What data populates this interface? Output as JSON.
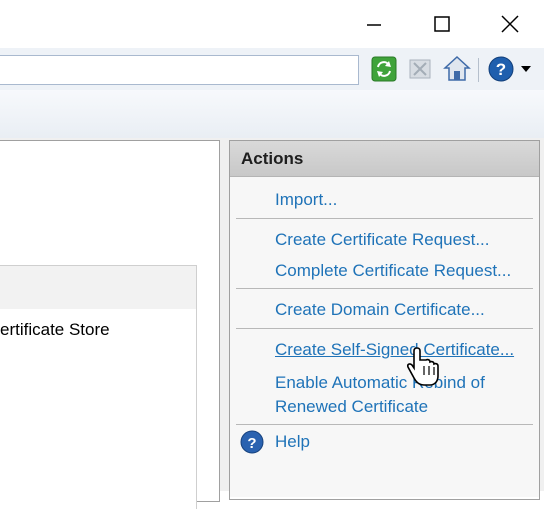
{
  "window": {
    "controls": {
      "minimize": "minimize-icon",
      "maximize": "maximize-icon",
      "close": "close-icon"
    }
  },
  "toolbar": {
    "address_value": "",
    "buttons": [
      "refresh-icon",
      "stop-icon",
      "home-icon",
      "help-icon",
      "dropdown-arrow-icon"
    ]
  },
  "content": {
    "cell_text": "ertificate Store"
  },
  "actions": {
    "title": "Actions",
    "import": "Import...",
    "create_request": "Create Certificate Request...",
    "complete_request": "Complete Certificate Request...",
    "create_domain": "Create Domain Certificate...",
    "create_self_signed": "Create Self-Signed Certificate...",
    "rebind_line1": "Enable Automatic Rebind of",
    "rebind_line2": "Renewed Certificate",
    "help": "Help"
  },
  "colors": {
    "link": "#1f73b8",
    "header_bg": "#d2d2d2",
    "pane_bg": "#f7f7f7"
  }
}
